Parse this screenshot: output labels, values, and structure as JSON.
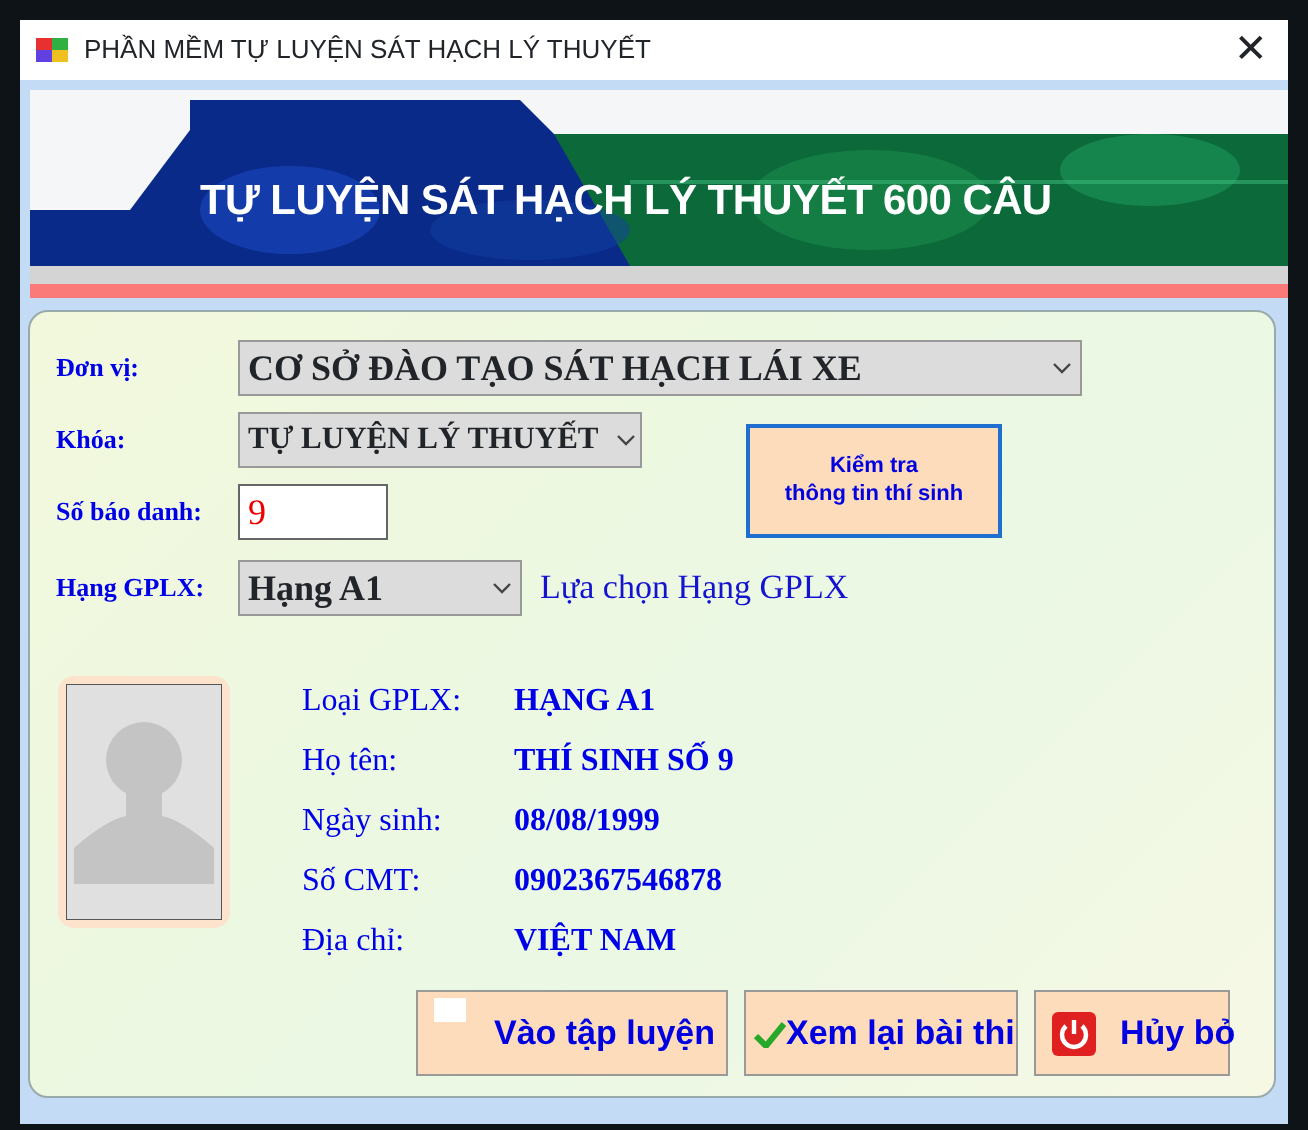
{
  "window": {
    "title": "PHẦN MỀM TỰ LUYỆN SÁT HẠCH LÝ THUYẾT",
    "close": "✕"
  },
  "banner": {
    "title": "TỰ LUYỆN SÁT HẠCH LÝ THUYẾT 600 CÂU"
  },
  "form": {
    "unit": {
      "label": "Đơn vị:",
      "value": "CƠ SỞ ĐÀO TẠO SÁT HẠCH LÁI XE"
    },
    "course": {
      "label": "Khóa:",
      "value": "TỰ LUYỆN LÝ THUYẾT"
    },
    "candidate_number": {
      "label": "Số báo danh:",
      "value": "9"
    },
    "license_class": {
      "label": "Hạng GPLX:",
      "value": "Hạng A1",
      "hint": "Lựa chọn Hạng GPLX"
    },
    "check_button": "Kiểm tra\nthông tin thí sinh"
  },
  "candidate_info": [
    {
      "label": "Loại GPLX:",
      "value": "HẠNG A1"
    },
    {
      "label": "Họ tên:",
      "value": "THÍ SINH SỐ 9"
    },
    {
      "label": "Ngày sinh:",
      "value": "08/08/1999"
    },
    {
      "label": "Số CMT:",
      "value": "0902367546878"
    },
    {
      "label": "Địa chỉ:",
      "value": "VIỆT NAM"
    }
  ],
  "buttons": [
    {
      "kind": "blank",
      "label": "Vào tập luyện"
    },
    {
      "kind": "check",
      "label": "Xem lại bài thi"
    },
    {
      "kind": "power",
      "label": "Hủy bỏ"
    }
  ]
}
